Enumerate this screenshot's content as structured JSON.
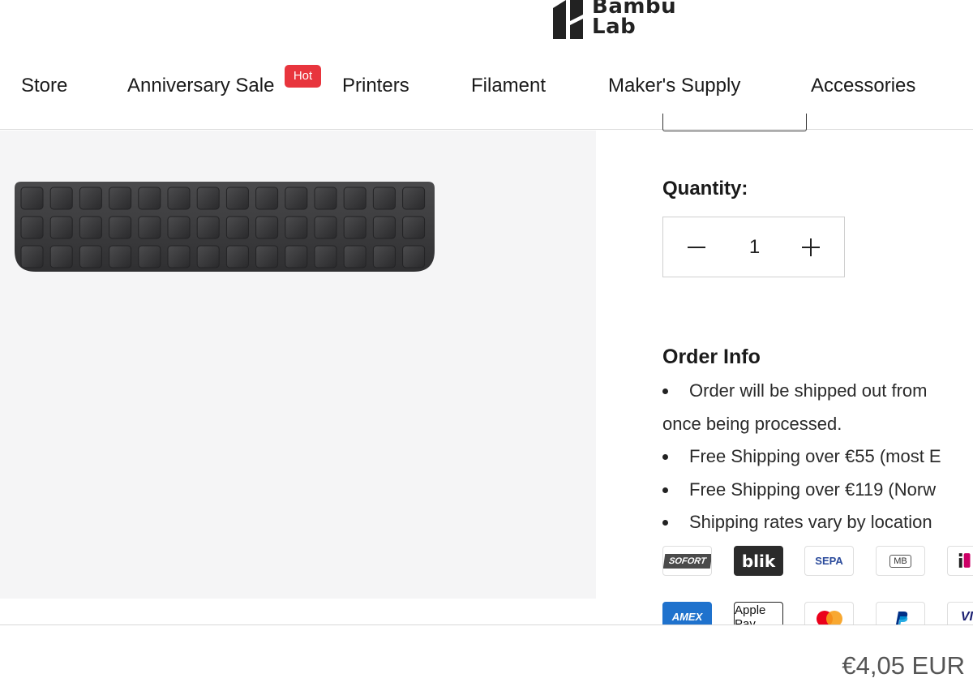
{
  "brand": {
    "logo_line1": "Bambu",
    "logo_line2": "Lab"
  },
  "nav": {
    "items": [
      {
        "label": "Store"
      },
      {
        "label": "Anniversary Sale"
      },
      {
        "label": "Printers"
      },
      {
        "label": "Filament"
      },
      {
        "label": "Maker's Supply"
      },
      {
        "label": "Accessories"
      }
    ],
    "hot_badge": "Hot"
  },
  "quantity": {
    "label": "Quantity:",
    "value": "1",
    "minus": "−",
    "plus": "+"
  },
  "order_info": {
    "title": "Order Info",
    "lines": [
      "Order will be shipped out from",
      "once being processed.",
      "Free Shipping over €55 (most E",
      "Free Shipping over €119 (Norw",
      "Shipping rates vary by location"
    ]
  },
  "payment_methods": {
    "row1": [
      "SOFORT",
      "blik",
      "SEPA",
      "MB",
      "iDEAL"
    ],
    "row2": [
      "AMEX",
      "Apple Pay",
      "Mastercard",
      "PayPal",
      "VISA"
    ]
  },
  "price": "€4,05 EUR",
  "colors": {
    "hot": "#e8353d",
    "image_bg": "#f5f5f6",
    "keypad": "#3b3b3d"
  }
}
